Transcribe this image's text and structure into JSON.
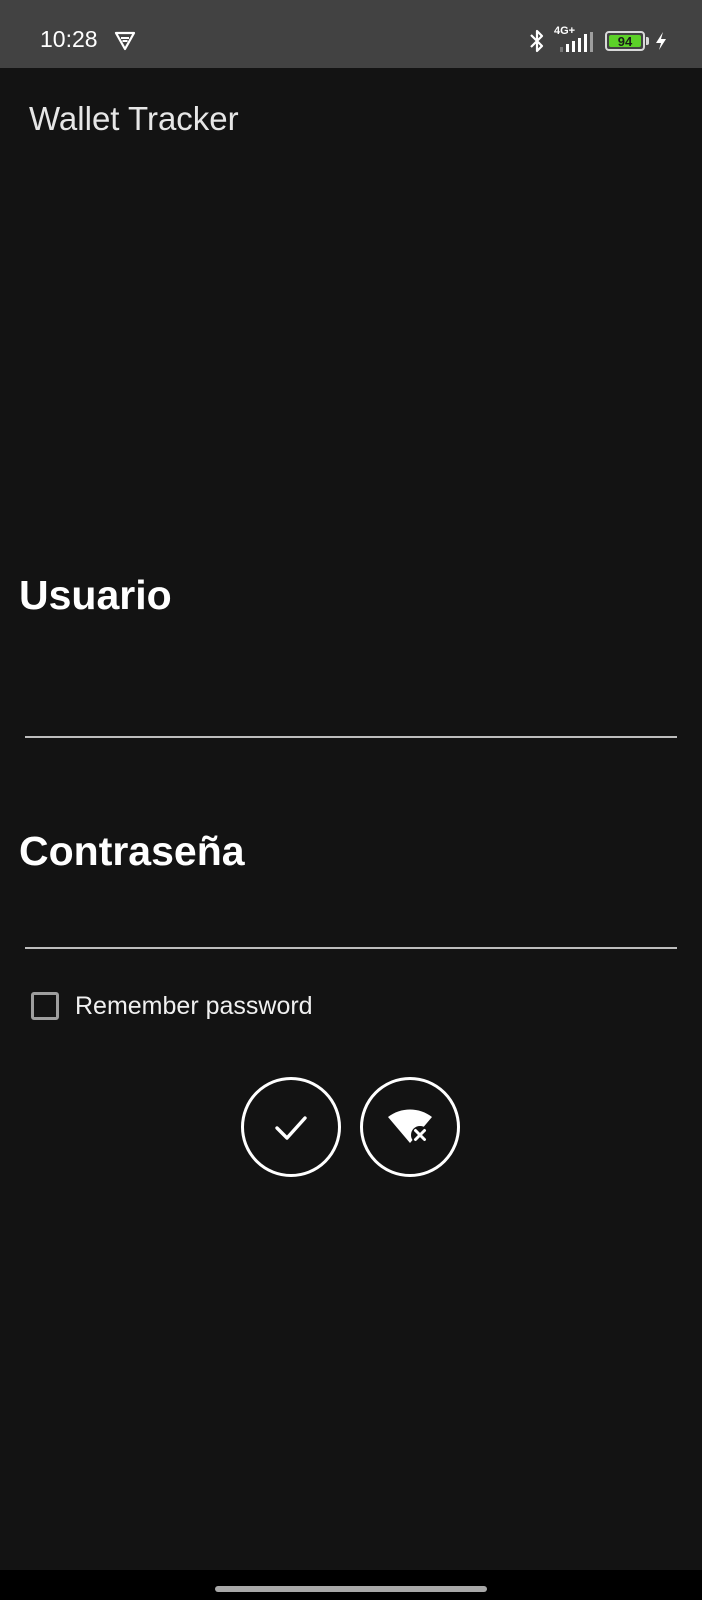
{
  "status_bar": {
    "time": "10:28",
    "network": "4G+",
    "battery_level": "94",
    "icons": [
      "vpn-icon",
      "bluetooth-icon",
      "signal-icon",
      "battery-icon",
      "charging-bolt-icon"
    ]
  },
  "app_bar": {
    "title": "Wallet Tracker"
  },
  "form": {
    "username_label": "Usuario",
    "username_value": "",
    "password_label": "Contraseña",
    "password_value": "",
    "remember_label": "Remember password",
    "remember_checked": false
  },
  "actions": {
    "confirm_icon": "check-icon",
    "offline_icon": "wifi-off-icon"
  },
  "colors": {
    "background": "#131313",
    "status_bar": "#424242",
    "battery": "#5cd128",
    "accent": "#ffffff"
  }
}
